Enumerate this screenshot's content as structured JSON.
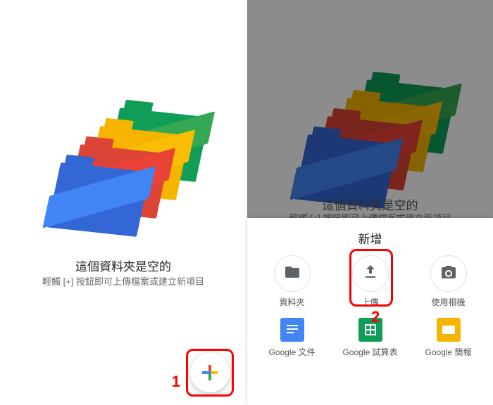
{
  "empty_state": {
    "title": "這個資料夾是空的",
    "subtitle": "輕觸 [+] 按鈕即可上傳檔案或建立新項目"
  },
  "callouts": {
    "one": "1",
    "two": "2"
  },
  "sheet": {
    "title": "新增",
    "items": [
      {
        "label": "資料夾"
      },
      {
        "label": "上傳"
      },
      {
        "label": "使用相機"
      },
      {
        "label": "Google 文件"
      },
      {
        "label": "Google 試算表"
      },
      {
        "label": "Google 簡報"
      }
    ]
  }
}
